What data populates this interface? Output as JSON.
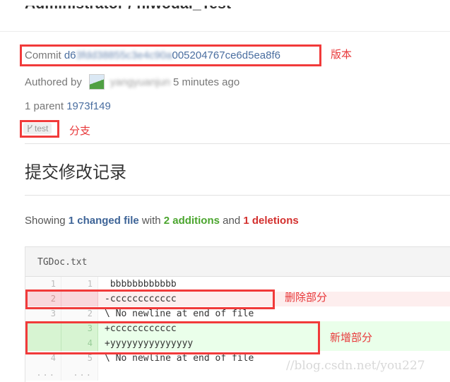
{
  "header": {
    "title": "Administrator / niwodai_Test"
  },
  "commit": {
    "label": "Commit",
    "hash_visible_start": "d6",
    "hash_obscured": "3fdd38855c3e4c90a",
    "hash_visible_end": "005204767ce6d5ea8f6"
  },
  "author": {
    "label": "Authored by",
    "name_obscured": "yangyuanjun",
    "time": "5 minutes ago"
  },
  "parent": {
    "label": "1 parent",
    "hash": "1973f149"
  },
  "branch": {
    "icon": "branch-icon",
    "name": "test"
  },
  "section_title": "提交修改记录",
  "stats": {
    "prefix": "Showing",
    "changed": "1 changed file",
    "with": "with",
    "additions": "2 additions",
    "and": "and",
    "deletions": "1 deletions"
  },
  "file": {
    "name": "TGDoc.txt",
    "lines": [
      {
        "type": "context",
        "old": "1",
        "new": "1",
        "text": " bbbbbbbbbbbb"
      },
      {
        "type": "old",
        "old": "2",
        "new": "",
        "text": "-cccccccccccc"
      },
      {
        "type": "context",
        "old": "3",
        "new": "2",
        "text": "\\ No newline at end of file"
      },
      {
        "type": "new",
        "old": "",
        "new": "3",
        "text": "+cccccccccccc"
      },
      {
        "type": "new",
        "old": "",
        "new": "4",
        "text": "+yyyyyyyyyyyyyyy"
      },
      {
        "type": "context",
        "old": "4",
        "new": "5",
        "text": "\\ No newline at end of file"
      },
      {
        "type": "match",
        "old": "...",
        "new": "...",
        "text": ""
      }
    ]
  },
  "annotations": {
    "version": "版本",
    "branch": "分支",
    "deleted": "删除部分",
    "added": "新增部分"
  },
  "watermark": "//blog.csdn.net/you227",
  "colors": {
    "annotation_red": "#f13a3a",
    "link_blue": "#4a6ea0",
    "addition_green": "#4ba52e",
    "deletion_red": "#d3302e"
  }
}
